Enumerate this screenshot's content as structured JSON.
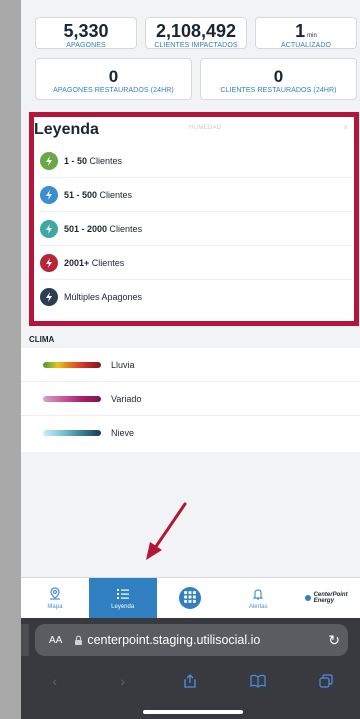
{
  "stats": {
    "apagones": {
      "value": "5,330",
      "label": "APAGONES"
    },
    "clientes": {
      "value": "2,108,492",
      "label": "CLIENTES IMPACTADOS"
    },
    "actualizado": {
      "value": "1",
      "unit": "min",
      "label": "ACTUALIZADO"
    },
    "restaurados": {
      "value": "0",
      "label": "APAGONES RESTAURADOS (24hr)"
    },
    "clientes_restaurados": {
      "value": "0",
      "label": "CLIENTES RESTAURADOS (24hr)"
    }
  },
  "legend": {
    "title": "Leyenda",
    "faint_text": "HUMEDAD",
    "items": [
      {
        "bold": "1 - 50",
        "rest": " Clientes",
        "color": "#6aa845"
      },
      {
        "bold": "51 - 500",
        "rest": " Clientes",
        "color": "#3a8fd1"
      },
      {
        "bold": "501 - 2000",
        "rest": " Clientes",
        "color": "#3fa8a2"
      },
      {
        "bold": "2001+",
        "rest": " Clientes",
        "color": "#b8253a"
      },
      {
        "bold": "",
        "rest": "Múltiples Apagones",
        "color": "#2b3e52"
      }
    ]
  },
  "clima": {
    "label": "CLIMA",
    "items": [
      {
        "label": "Lluvia"
      },
      {
        "label": "Variado"
      },
      {
        "label": "Nieve"
      }
    ]
  },
  "tabbar": {
    "mapa": "Mapa",
    "leyenda": "Leyenda",
    "alertas": "Alertas",
    "logo_line1": "CenterPoint",
    "logo_line2": "Energy"
  },
  "browser": {
    "aa": "AA",
    "url": "centerpoint.staging.utilisocial.io"
  },
  "colors": {
    "accent": "#2f7fc1",
    "highlight_border": "#b3163a"
  }
}
